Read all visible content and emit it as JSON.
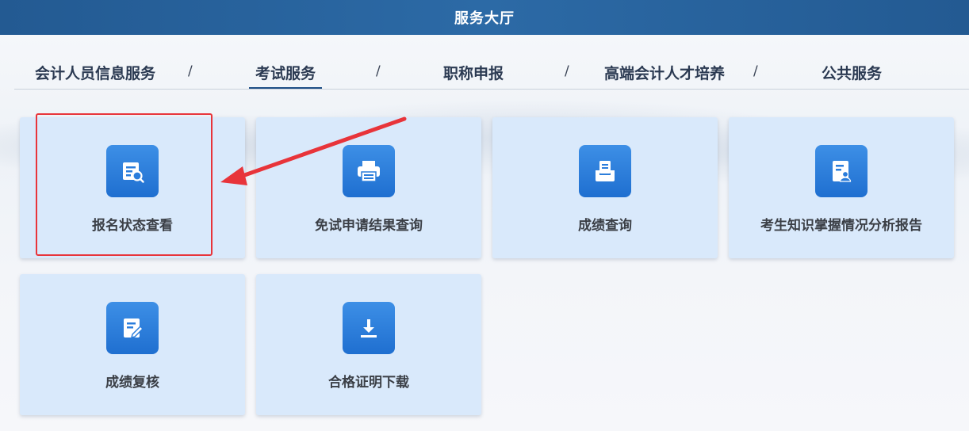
{
  "header": {
    "title": "服务大厅"
  },
  "tabs": [
    {
      "label": "会计人员信息服务"
    },
    {
      "label": "考试服务",
      "active": true
    },
    {
      "label": "职称申报"
    },
    {
      "label": "高端会计人才培养"
    },
    {
      "label": "公共服务"
    }
  ],
  "separator": "/",
  "services": [
    {
      "label": "报名状态查看",
      "icon": "document-search-icon",
      "highlighted": true
    },
    {
      "label": "免试申请结果查询",
      "icon": "printer-icon"
    },
    {
      "label": "成绩查询",
      "icon": "inbox-document-icon"
    },
    {
      "label": "考生知识掌握情况分析报告",
      "icon": "document-user-icon"
    },
    {
      "label": "成绩复核",
      "icon": "document-edit-icon"
    },
    {
      "label": "合格证明下载",
      "icon": "download-icon"
    }
  ],
  "colors": {
    "header_bg": "#2c6aa6",
    "card_bg": "#d9e9fb",
    "icon_bg": "#2a7ddc",
    "highlight": "#e8343a"
  }
}
